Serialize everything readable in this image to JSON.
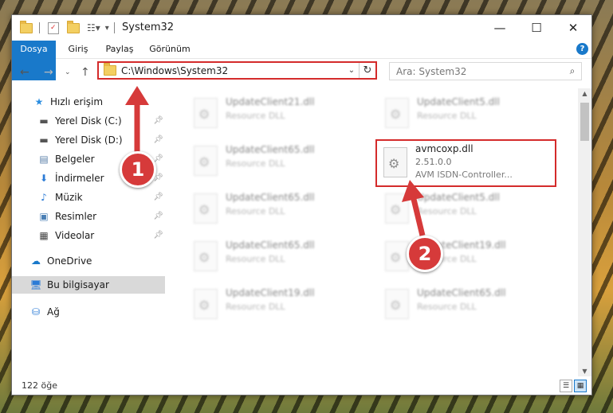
{
  "window": {
    "title": "System32",
    "controls": {
      "minimize": "—",
      "maximize": "☐",
      "close": "✕"
    }
  },
  "ribbon": {
    "tabs": [
      "Dosya",
      "Giriş",
      "Paylaş",
      "Görünüm"
    ],
    "help": "?"
  },
  "address_bar": {
    "path": "C:\\Windows\\System32",
    "search_placeholder": "Ara: System32"
  },
  "nav_pane": {
    "items": [
      {
        "label": "Hızlı erişim",
        "icon": "star-icon"
      },
      {
        "label": "Yerel Disk (C:)",
        "icon": "drive-icon",
        "pinned": true
      },
      {
        "label": "Yerel Disk (D:)",
        "icon": "drive-icon",
        "pinned": true
      },
      {
        "label": "Belgeler",
        "icon": "document-icon",
        "pinned": true
      },
      {
        "label": "İndirmeler",
        "icon": "download-icon",
        "pinned": true
      },
      {
        "label": "Müzik",
        "icon": "music-icon",
        "pinned": true
      },
      {
        "label": "Resimler",
        "icon": "pictures-icon",
        "pinned": true
      },
      {
        "label": "Videolar",
        "icon": "video-icon",
        "pinned": true
      },
      {
        "label": "OneDrive",
        "icon": "cloud-icon"
      },
      {
        "label": "Bu bilgisayar",
        "icon": "computer-icon",
        "selected": true
      },
      {
        "label": "Ağ",
        "icon": "network-icon"
      }
    ]
  },
  "files": {
    "left_column": [
      {
        "name": "UpdateClient21.dll",
        "desc": "Resource DLL"
      },
      {
        "name": "UpdateClient65.dll",
        "desc": "Resource DLL"
      },
      {
        "name": "UpdateClient65.dll",
        "desc": "Resource DLL"
      },
      {
        "name": "UpdateClient65.dll",
        "desc": "Resource DLL"
      },
      {
        "name": "UpdateClient19.dll",
        "desc": "Resource DLL"
      }
    ],
    "right_column": [
      {
        "name": "UpdateClient5.dll",
        "desc": "Resource DLL"
      },
      {
        "name": "UpdateClient5.dll",
        "desc": "Resource DLL"
      },
      {
        "name": "UpdateClient19.dll",
        "desc": "Resource DLL"
      },
      {
        "name": "UpdateClient65.dll",
        "desc": "Resource DLL"
      }
    ],
    "highlighted": {
      "name": "avmcoxp.dll",
      "version": "2.51.0.0",
      "desc": "AVM ISDN-Controller..."
    }
  },
  "status_bar": {
    "item_count": "122 öğe"
  },
  "annotations": {
    "step1": "1",
    "step2": "2",
    "color": "#d63a3a"
  }
}
